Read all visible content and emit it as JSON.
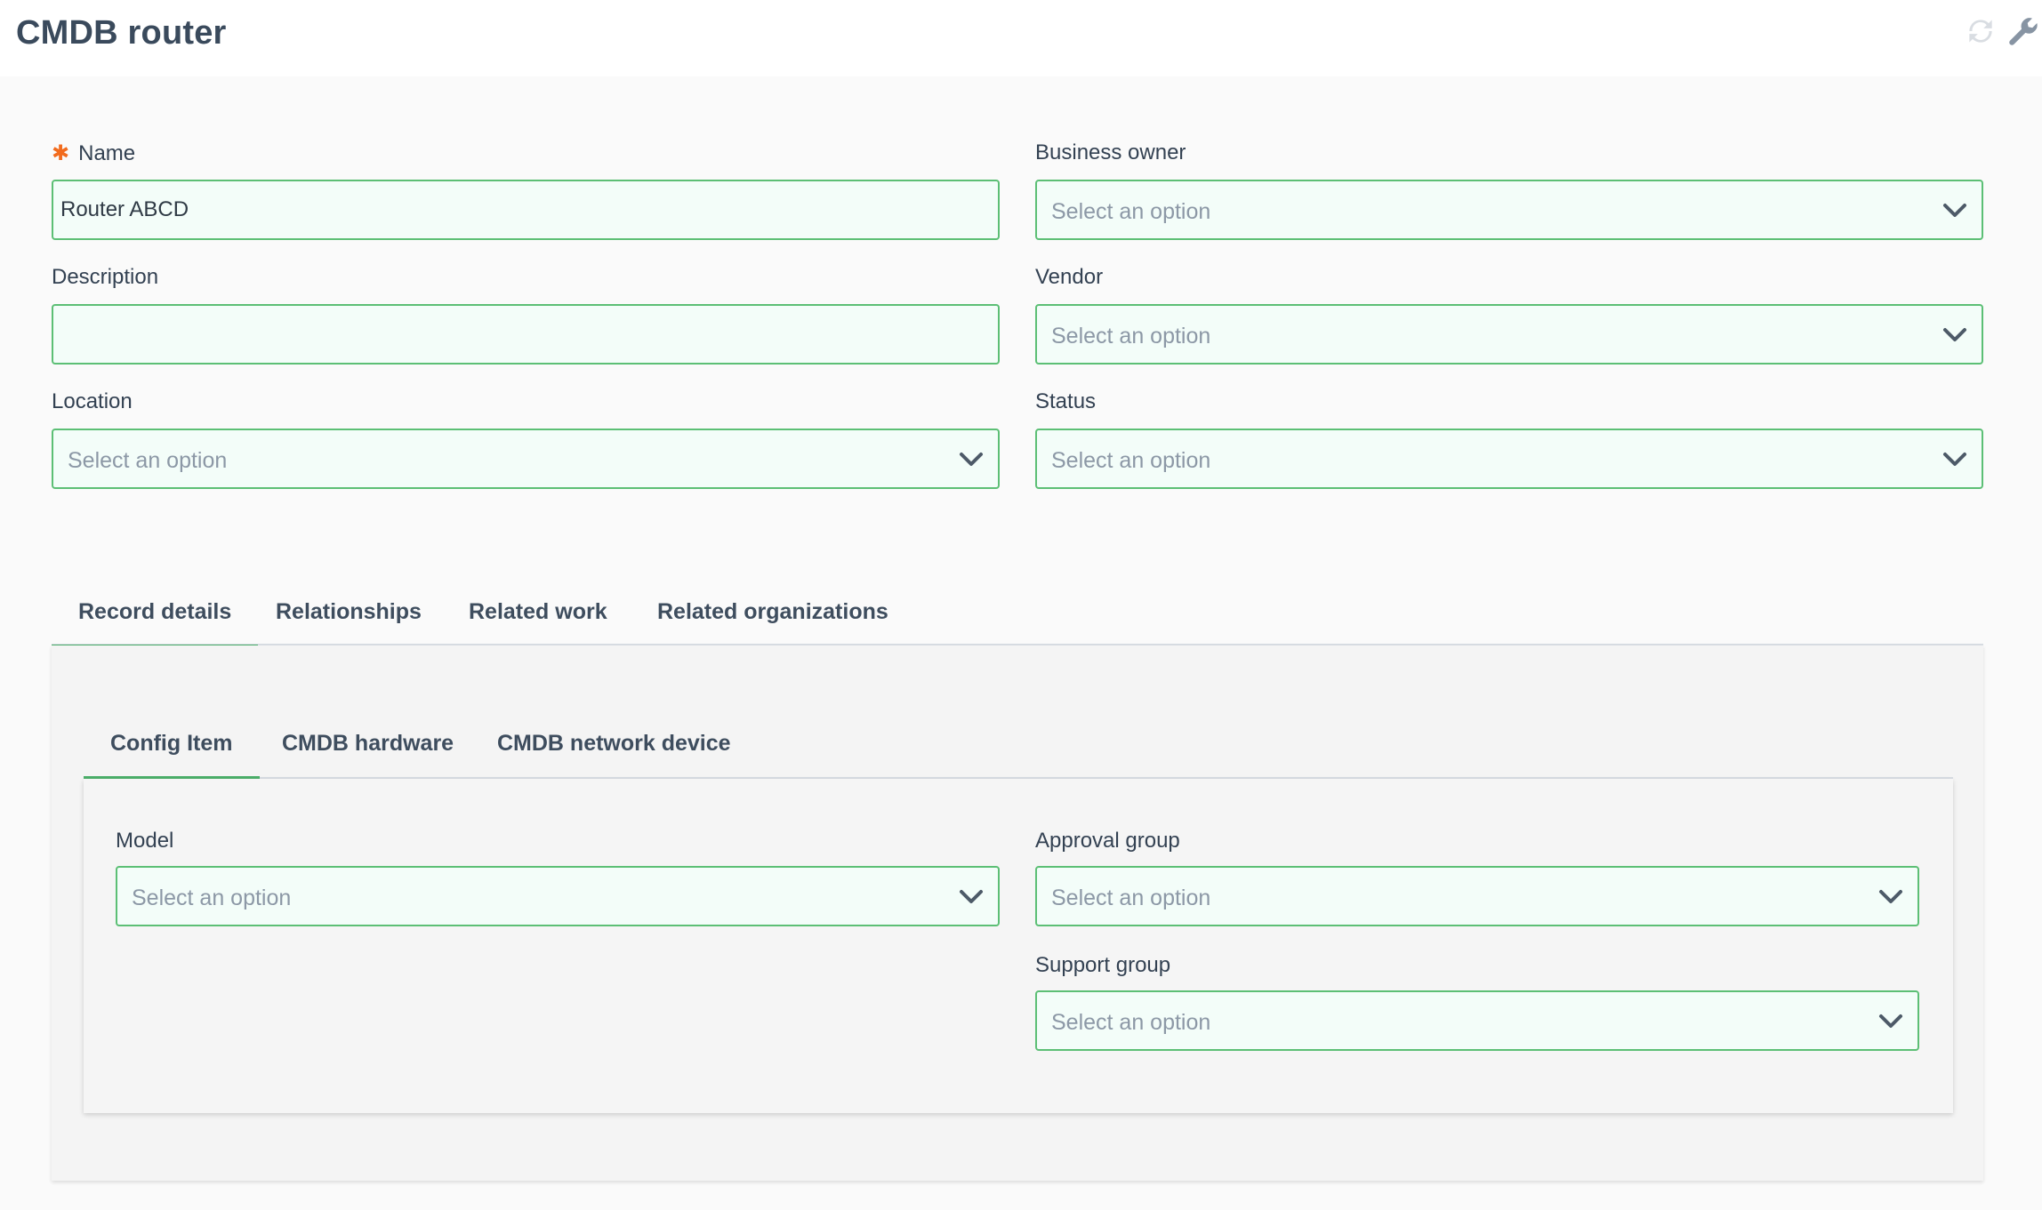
{
  "header": {
    "title": "CMDB router",
    "refresh_icon": "refresh-icon",
    "wrench_icon": "wrench-icon"
  },
  "form": {
    "name": {
      "label": "Name",
      "required_marker": "✱",
      "value": "Router ABCD"
    },
    "description": {
      "label": "Description",
      "value": ""
    },
    "location": {
      "label": "Location",
      "placeholder": "Select an option"
    },
    "business_owner": {
      "label": "Business owner",
      "placeholder": "Select an option"
    },
    "vendor": {
      "label": "Vendor",
      "placeholder": "Select an option"
    },
    "status": {
      "label": "Status",
      "placeholder": "Select an option"
    }
  },
  "tabs": [
    {
      "label": "Record details",
      "active": true
    },
    {
      "label": "Relationships",
      "active": false
    },
    {
      "label": "Related work",
      "active": false
    },
    {
      "label": "Related organizations",
      "active": false
    }
  ],
  "subtabs": [
    {
      "label": "Config Item",
      "active": true
    },
    {
      "label": "CMDB hardware",
      "active": false
    },
    {
      "label": "CMDB network device",
      "active": false
    }
  ],
  "config_item": {
    "model": {
      "label": "Model",
      "placeholder": "Select an option"
    },
    "approval_group": {
      "label": "Approval group",
      "placeholder": "Select an option"
    },
    "support_group": {
      "label": "Support group",
      "placeholder": "Select an option"
    }
  },
  "colors": {
    "field_border": "#5cbf75",
    "field_bg": "#f3fdf9",
    "tab_active_underline": "#4caf6a",
    "required": "#f26b1d"
  }
}
